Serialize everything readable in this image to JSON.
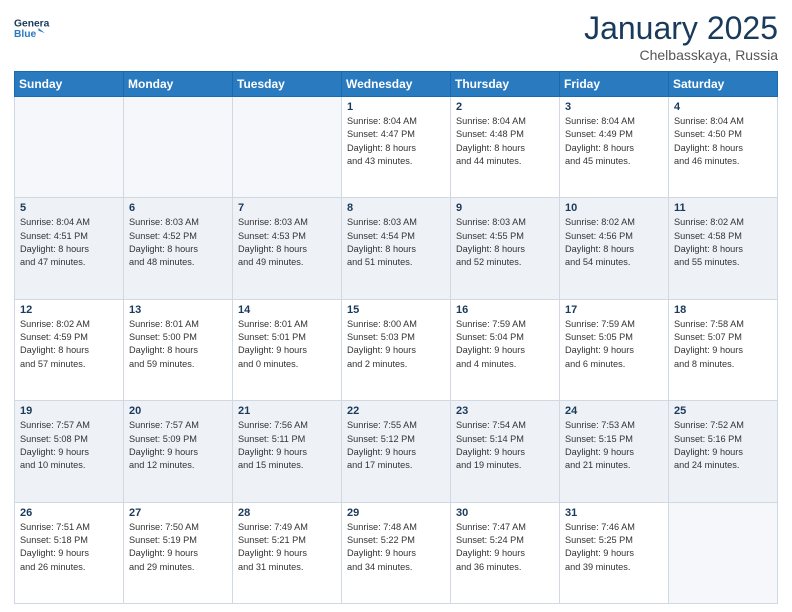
{
  "header": {
    "logo_line1": "General",
    "logo_line2": "Blue",
    "title": "January 2025",
    "subtitle": "Chelbasskaya, Russia"
  },
  "weekdays": [
    "Sunday",
    "Monday",
    "Tuesday",
    "Wednesday",
    "Thursday",
    "Friday",
    "Saturday"
  ],
  "weeks": [
    [
      {
        "day": "",
        "info": ""
      },
      {
        "day": "",
        "info": ""
      },
      {
        "day": "",
        "info": ""
      },
      {
        "day": "1",
        "info": "Sunrise: 8:04 AM\nSunset: 4:47 PM\nDaylight: 8 hours\nand 43 minutes."
      },
      {
        "day": "2",
        "info": "Sunrise: 8:04 AM\nSunset: 4:48 PM\nDaylight: 8 hours\nand 44 minutes."
      },
      {
        "day": "3",
        "info": "Sunrise: 8:04 AM\nSunset: 4:49 PM\nDaylight: 8 hours\nand 45 minutes."
      },
      {
        "day": "4",
        "info": "Sunrise: 8:04 AM\nSunset: 4:50 PM\nDaylight: 8 hours\nand 46 minutes."
      }
    ],
    [
      {
        "day": "5",
        "info": "Sunrise: 8:04 AM\nSunset: 4:51 PM\nDaylight: 8 hours\nand 47 minutes."
      },
      {
        "day": "6",
        "info": "Sunrise: 8:03 AM\nSunset: 4:52 PM\nDaylight: 8 hours\nand 48 minutes."
      },
      {
        "day": "7",
        "info": "Sunrise: 8:03 AM\nSunset: 4:53 PM\nDaylight: 8 hours\nand 49 minutes."
      },
      {
        "day": "8",
        "info": "Sunrise: 8:03 AM\nSunset: 4:54 PM\nDaylight: 8 hours\nand 51 minutes."
      },
      {
        "day": "9",
        "info": "Sunrise: 8:03 AM\nSunset: 4:55 PM\nDaylight: 8 hours\nand 52 minutes."
      },
      {
        "day": "10",
        "info": "Sunrise: 8:02 AM\nSunset: 4:56 PM\nDaylight: 8 hours\nand 54 minutes."
      },
      {
        "day": "11",
        "info": "Sunrise: 8:02 AM\nSunset: 4:58 PM\nDaylight: 8 hours\nand 55 minutes."
      }
    ],
    [
      {
        "day": "12",
        "info": "Sunrise: 8:02 AM\nSunset: 4:59 PM\nDaylight: 8 hours\nand 57 minutes."
      },
      {
        "day": "13",
        "info": "Sunrise: 8:01 AM\nSunset: 5:00 PM\nDaylight: 8 hours\nand 59 minutes."
      },
      {
        "day": "14",
        "info": "Sunrise: 8:01 AM\nSunset: 5:01 PM\nDaylight: 9 hours\nand 0 minutes."
      },
      {
        "day": "15",
        "info": "Sunrise: 8:00 AM\nSunset: 5:03 PM\nDaylight: 9 hours\nand 2 minutes."
      },
      {
        "day": "16",
        "info": "Sunrise: 7:59 AM\nSunset: 5:04 PM\nDaylight: 9 hours\nand 4 minutes."
      },
      {
        "day": "17",
        "info": "Sunrise: 7:59 AM\nSunset: 5:05 PM\nDaylight: 9 hours\nand 6 minutes."
      },
      {
        "day": "18",
        "info": "Sunrise: 7:58 AM\nSunset: 5:07 PM\nDaylight: 9 hours\nand 8 minutes."
      }
    ],
    [
      {
        "day": "19",
        "info": "Sunrise: 7:57 AM\nSunset: 5:08 PM\nDaylight: 9 hours\nand 10 minutes."
      },
      {
        "day": "20",
        "info": "Sunrise: 7:57 AM\nSunset: 5:09 PM\nDaylight: 9 hours\nand 12 minutes."
      },
      {
        "day": "21",
        "info": "Sunrise: 7:56 AM\nSunset: 5:11 PM\nDaylight: 9 hours\nand 15 minutes."
      },
      {
        "day": "22",
        "info": "Sunrise: 7:55 AM\nSunset: 5:12 PM\nDaylight: 9 hours\nand 17 minutes."
      },
      {
        "day": "23",
        "info": "Sunrise: 7:54 AM\nSunset: 5:14 PM\nDaylight: 9 hours\nand 19 minutes."
      },
      {
        "day": "24",
        "info": "Sunrise: 7:53 AM\nSunset: 5:15 PM\nDaylight: 9 hours\nand 21 minutes."
      },
      {
        "day": "25",
        "info": "Sunrise: 7:52 AM\nSunset: 5:16 PM\nDaylight: 9 hours\nand 24 minutes."
      }
    ],
    [
      {
        "day": "26",
        "info": "Sunrise: 7:51 AM\nSunset: 5:18 PM\nDaylight: 9 hours\nand 26 minutes."
      },
      {
        "day": "27",
        "info": "Sunrise: 7:50 AM\nSunset: 5:19 PM\nDaylight: 9 hours\nand 29 minutes."
      },
      {
        "day": "28",
        "info": "Sunrise: 7:49 AM\nSunset: 5:21 PM\nDaylight: 9 hours\nand 31 minutes."
      },
      {
        "day": "29",
        "info": "Sunrise: 7:48 AM\nSunset: 5:22 PM\nDaylight: 9 hours\nand 34 minutes."
      },
      {
        "day": "30",
        "info": "Sunrise: 7:47 AM\nSunset: 5:24 PM\nDaylight: 9 hours\nand 36 minutes."
      },
      {
        "day": "31",
        "info": "Sunrise: 7:46 AM\nSunset: 5:25 PM\nDaylight: 9 hours\nand 39 minutes."
      },
      {
        "day": "",
        "info": ""
      }
    ]
  ]
}
